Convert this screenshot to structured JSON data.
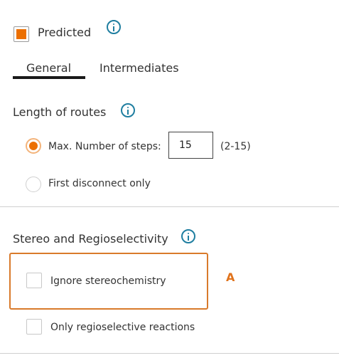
{
  "predicted": {
    "label": "Predicted",
    "checked": true
  },
  "tabs": [
    {
      "label": "General",
      "active": true
    },
    {
      "label": "Intermediates",
      "active": false
    }
  ],
  "length_of_routes": {
    "heading": "Length of routes",
    "options": [
      {
        "label": "Max. Number of steps:",
        "selected": true
      },
      {
        "label": "First disconnect only",
        "selected": false
      }
    ],
    "steps_value": "15",
    "steps_range": "(2-15)"
  },
  "stereo": {
    "heading": "Stereo and Regioselectivity",
    "options": [
      {
        "label": "Ignore stereochemistry",
        "checked": false
      },
      {
        "label": "Only regioselective reactions",
        "checked": false
      }
    ]
  },
  "annotation": {
    "letter": "A"
  },
  "colors": {
    "accent": "#ec6f00",
    "info": "#1f7ea0",
    "annotation": "#d97a2b"
  },
  "icons": [
    "info-icon"
  ]
}
